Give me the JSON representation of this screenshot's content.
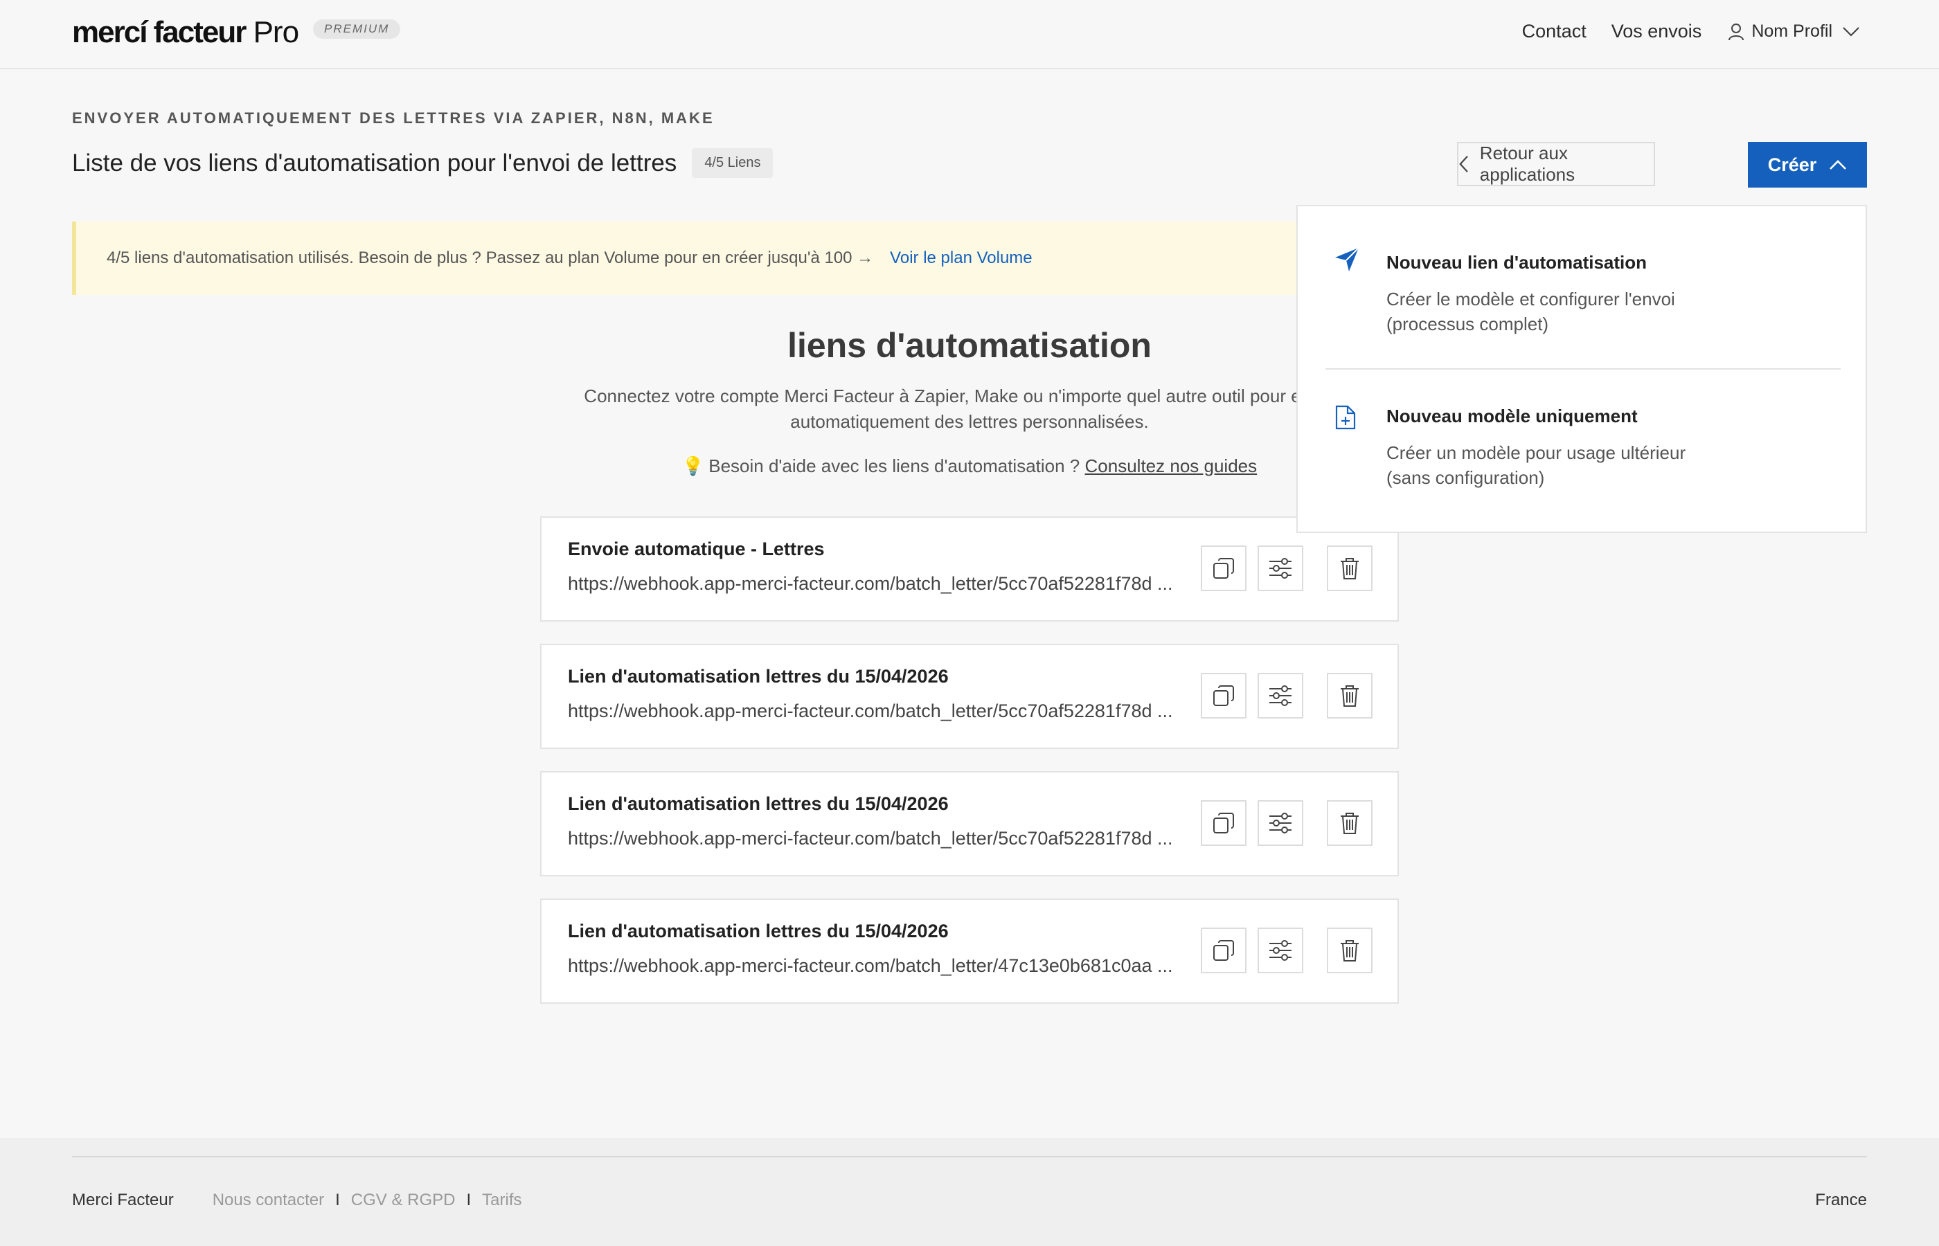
{
  "header": {
    "logo_main": "mercí facteur",
    "logo_pro": " Pro",
    "badge": "PREMIUM",
    "nav": {
      "contact": "Contact",
      "shipments": "Vos envois",
      "profile": "Nom Profil"
    }
  },
  "page": {
    "eyebrow": "ENVOYER AUTOMATIQUEMENT DES LETTRES VIA ZAPIER, N8N, MAKE",
    "title": "Liste de vos liens d'automatisation pour l'envoi de lettres",
    "count_badge": "4/5 Liens",
    "back_button": "Retour aux applications",
    "create_button": "Créer"
  },
  "notice": {
    "text": "4/5 liens d'automatisation utilisés. Besoin de plus ? Passez au plan Volume pour en créer jusqu'à 100 →",
    "link": "Voir le plan Volume"
  },
  "section": {
    "title": "liens d'automatisation",
    "subtitle": "Connectez votre compte Merci Facteur à Zapier, Make ou n'importe quel autre outil pour envoyer automatiquement des lettres personnalisées.",
    "help_text": "Besoin d'aide avec les liens d'automatisation ?",
    "help_link": "Consultez nos guides"
  },
  "links": [
    {
      "name": "Envoie automatique - Lettres",
      "url": "https://webhook.app-merci-facteur.com/batch_letter/5cc70af52281f78d ..."
    },
    {
      "name": "Lien d'automatisation lettres du 15/04/2026",
      "url": "https://webhook.app-merci-facteur.com/batch_letter/5cc70af52281f78d ..."
    },
    {
      "name": "Lien d'automatisation lettres du 15/04/2026",
      "url": "https://webhook.app-merci-facteur.com/batch_letter/5cc70af52281f78d ..."
    },
    {
      "name": "Lien d'automatisation lettres du 15/04/2026",
      "url": "https://webhook.app-merci-facteur.com/batch_letter/47c13e0b681c0aa ..."
    }
  ],
  "dropdown": {
    "items": [
      {
        "title": "Nouveau lien d'automatisation",
        "desc_line1": "Créer le modèle et configurer l'envoi",
        "desc_line2": "(processus complet)",
        "icon": "send-icon"
      },
      {
        "title": "Nouveau modèle uniquement",
        "desc_line1": "Créer un modèle pour usage ultérieur",
        "desc_line2": "(sans configuration)",
        "icon": "file-plus-icon"
      }
    ]
  },
  "footer": {
    "brand": "Merci Facteur",
    "links": [
      "Nous contacter",
      "CGV & RGPD",
      "Tarifs"
    ],
    "separator": "I",
    "country": "France"
  },
  "colors": {
    "accent": "#1560bd",
    "notice_bg": "#fdf9e3",
    "page_bg": "#f7f7f7"
  }
}
